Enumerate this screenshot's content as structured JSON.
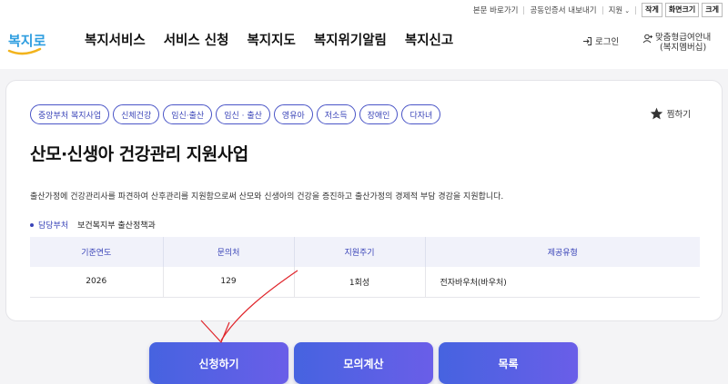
{
  "utility": {
    "skip_link": "본문 바로가기",
    "cert_export": "공동인증서 내보내기",
    "support": "지원",
    "font_small": "작게",
    "font_size": "화면크기",
    "font_large": "크게"
  },
  "logo": {
    "text": "복지로"
  },
  "nav": [
    "복지서비스",
    "서비스 신청",
    "복지지도",
    "복지위기알림",
    "복지신고"
  ],
  "header_right": {
    "login": "로그인",
    "guide_line1": "맞춤형급여안내",
    "guide_line2": "(복지멤버십)"
  },
  "tags": [
    "중앙부처 복지사업",
    "신체건강",
    "임신·출산",
    "임신 · 출산",
    "영유아",
    "저소득",
    "장애인",
    "다자녀"
  ],
  "favorite_label": "찜하기",
  "title": "산모·신생아 건강관리 지원사업",
  "description": "출산가정에 건강관리사를 파견하여 산후관리를 지원함으로써 산모와 신생아의 건강을 증진하고 출산가정의 경제적 부담 경감을 지원합니다.",
  "department": {
    "label": "담당부처",
    "value": "보건복지부 출산정책과"
  },
  "table": {
    "headers": [
      "기준연도",
      "문의처",
      "지원주기",
      "제공유형"
    ],
    "row": [
      "2026",
      "129",
      "1회성",
      "전자바우처(바우처)"
    ]
  },
  "buttons": {
    "apply": "신청하기",
    "simulate": "모의계산",
    "list": "목록"
  },
  "colors": {
    "accent": "#3a44b8",
    "button_start": "#4663e0",
    "button_end": "#6a5ee8",
    "annotation": "#e0242a"
  }
}
